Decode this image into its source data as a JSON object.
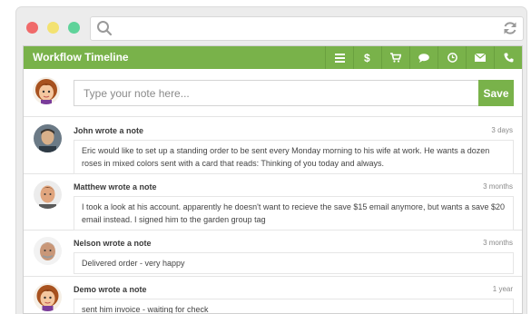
{
  "app": {
    "title": "Workflow Timeline",
    "accent": "#79b24a",
    "toolbar": [
      {
        "icon": "list-icon"
      },
      {
        "icon": "dollar-icon"
      },
      {
        "icon": "cart-icon"
      },
      {
        "icon": "comment-icon"
      },
      {
        "icon": "clock-icon"
      },
      {
        "icon": "envelope-icon"
      },
      {
        "icon": "phone-icon"
      }
    ]
  },
  "compose": {
    "placeholder": "Type your note here...",
    "save_label": "Save"
  },
  "notes": [
    {
      "author": "John wrote a note",
      "time": "3 days",
      "body": "Eric would like to set up a standing order to be sent every Monday morning to his wife at work. He wants a dozen roses in mixed colors sent with a card that reads: Thinking of you today and always."
    },
    {
      "author": "Matthew wrote a note",
      "time": "3 months",
      "body": "I took a look at his account. apparently he doesn't want to recieve the save $15 email anymore, but wants a save $20 email instead. I signed him to the garden group tag"
    },
    {
      "author": "Nelson wrote a note",
      "time": "3 months",
      "body": "Delivered order - very happy"
    },
    {
      "author": "Demo wrote a note",
      "time": "1 year",
      "body": "sent him invoice - waiting for check"
    }
  ]
}
